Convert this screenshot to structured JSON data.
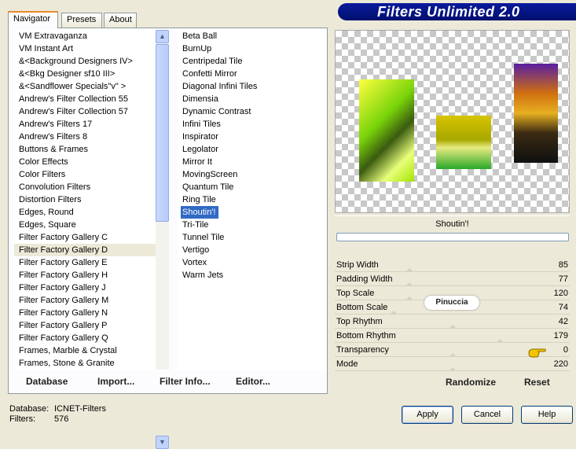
{
  "window": {
    "title": "Filters Unlimited 2.0"
  },
  "tabs": [
    {
      "label": "Navigator"
    },
    {
      "label": "Presets"
    },
    {
      "label": "About"
    }
  ],
  "categories": [
    "VM Extravaganza",
    "VM Instant Art",
    "&<Background Designers IV>",
    "&<Bkg Designer sf10 III>",
    "&<Sandflower Specials\"v\" >",
    "Andrew's Filter Collection 55",
    "Andrew's Filter Collection 57",
    "Andrew's Filters 17",
    "Andrew's Filters 8",
    "Buttons & Frames",
    "Color Effects",
    "Color Filters",
    "Convolution Filters",
    "Distortion Filters",
    "Edges, Round",
    "Edges, Square",
    "Filter Factory Gallery C",
    "Filter Factory Gallery D",
    "Filter Factory Gallery E",
    "Filter Factory Gallery H",
    "Filter Factory Gallery J",
    "Filter Factory Gallery M",
    "Filter Factory Gallery N",
    "Filter Factory Gallery P",
    "Filter Factory Gallery Q",
    "Frames, Marble & Crystal",
    "Frames, Stone & Granite"
  ],
  "selected_category": "Filter Factory Gallery D",
  "filters": [
    "Beta Ball",
    "BurnUp",
    "Centripedal Tile",
    "Confetti Mirror",
    "Diagonal Infini Tiles",
    "Dimensia",
    "Dynamic Contrast",
    "Infini Tiles",
    "Inspirator",
    "Legolator",
    "Mirror It",
    "MovingScreen",
    "Quantum Tile",
    "Ring Tile",
    "Shoutin'!",
    "Tri-Tile",
    "Tunnel Tile",
    "Vertigo",
    "Vortex",
    "Warm Jets"
  ],
  "selected_filter": "Shoutin'!",
  "bottom_buttons": {
    "database": "Database",
    "import": "Import...",
    "filter_info": "Filter Info...",
    "editor": "Editor..."
  },
  "preview": {
    "filter_name": "Shoutin'!"
  },
  "parameters": [
    {
      "label": "Strip Width",
      "value": "85"
    },
    {
      "label": "Padding Width",
      "value": "77"
    },
    {
      "label": "Top Scale",
      "value": "120"
    },
    {
      "label": "Bottom Scale",
      "value": "74"
    },
    {
      "label": "Top Rhythm",
      "value": "42"
    },
    {
      "label": "Bottom Rhythm",
      "value": "179"
    },
    {
      "label": "Transparency",
      "value": "0"
    },
    {
      "label": "Mode",
      "value": "220"
    }
  ],
  "watermark": "Pinuccia",
  "right_buttons": {
    "randomize": "Randomize",
    "reset": "Reset"
  },
  "status": {
    "database_label": "Database:",
    "database_value": "ICNET-Filters",
    "filters_label": "Filters:",
    "filters_value": "576"
  },
  "dialog_buttons": {
    "apply": "Apply",
    "cancel": "Cancel",
    "help": "Help"
  },
  "colors": {
    "banner": "#0a1a9c",
    "selection": "#316ac5",
    "background": "#ece9d8"
  }
}
